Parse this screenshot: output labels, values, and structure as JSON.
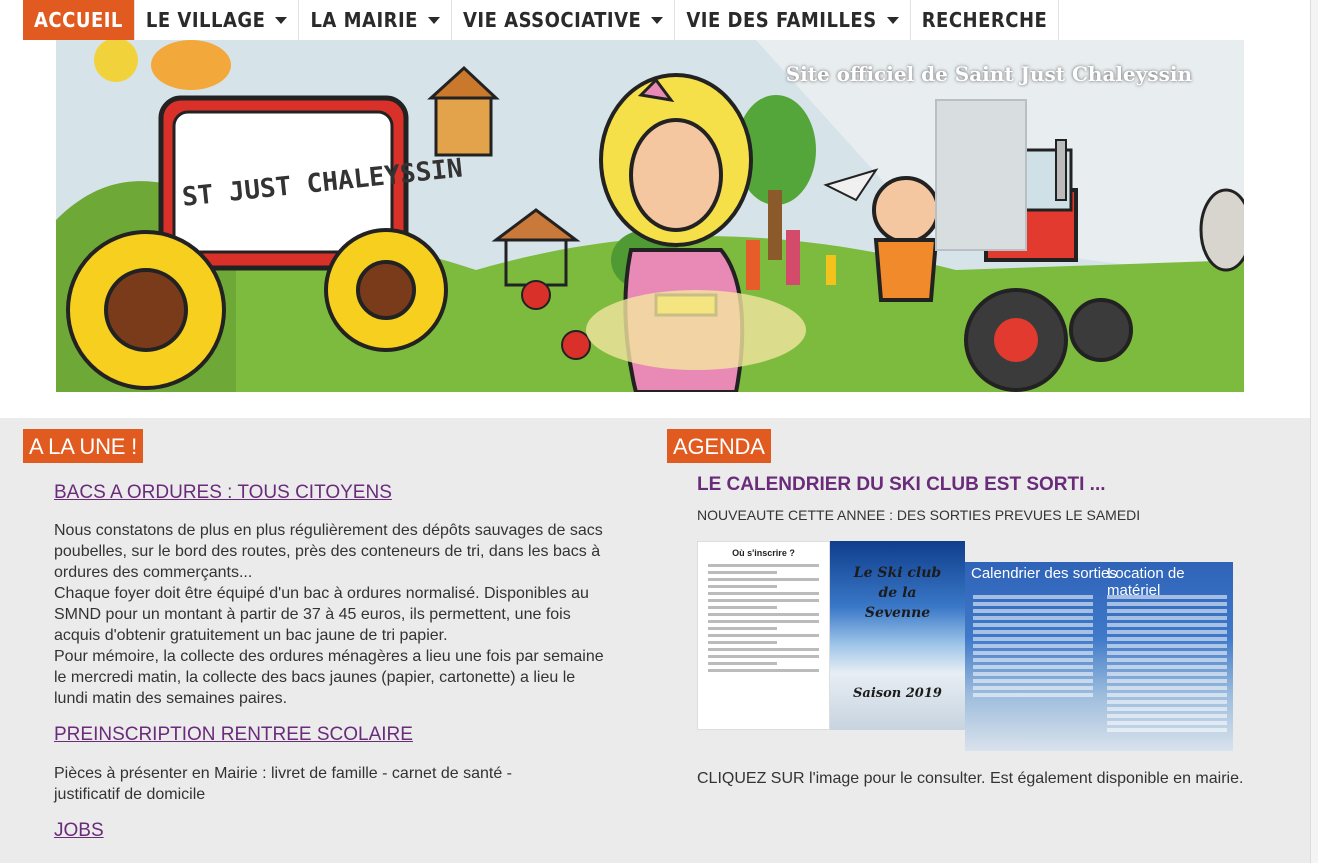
{
  "nav": {
    "items": [
      {
        "label": "ACCUEIL",
        "dropdown": false,
        "active": true
      },
      {
        "label": "LE VILLAGE",
        "dropdown": true,
        "active": false
      },
      {
        "label": "LA MAIRIE",
        "dropdown": true,
        "active": false
      },
      {
        "label": "VIE ASSOCIATIVE",
        "dropdown": true,
        "active": false
      },
      {
        "label": "VIE DES FAMILLES",
        "dropdown": true,
        "active": false
      },
      {
        "label": "RECHERCHE",
        "dropdown": false,
        "active": false
      }
    ]
  },
  "banner": {
    "title": "Site officiel de Saint Just Chaleyssin",
    "sign_text": "ST JUST CHALEYSSIN"
  },
  "une": {
    "heading": "A LA UNE !",
    "articles": [
      {
        "title": "BACS A ORDURES : TOUS CITOYENS",
        "paragraphs": [
          "Nous constatons de plus en plus régulièrement des dépôts sauvages de sacs poubelles, sur le bord des routes, près des conteneurs de tri, dans les bacs à ordures des commerçants...",
          "Chaque foyer doit être équipé d'un bac à ordures normalisé. Disponibles au SMND pour un montant à partir de 37 à 45 euros, ils permettent, une fois acquis d'obtenir gratuitement un bac jaune de tri papier.",
          "Pour mémoire, la collecte des ordures ménagères a lieu une fois par semaine le mercredi matin, la collecte des bacs jaunes (papier, cartonette) a lieu le lundi matin des semaines paires."
        ]
      },
      {
        "title": "PREINSCRIPTION RENTREE SCOLAIRE",
        "paragraphs": [
          "Pièces à présenter en Mairie : livret de famille - carnet de santé - justificatif de domicile"
        ]
      },
      {
        "title": "JOBS",
        "paragraphs": []
      }
    ]
  },
  "agenda": {
    "heading": "AGENDA",
    "title": "LE CALENDRIER DU SKI CLUB EST SORTI ...",
    "subtitle": "NOUVEAUTE CETTE ANNEE : DES SORTIES PREVUES LE SAMEDI",
    "cal_left_heading": "Où s'inscrire ?",
    "cal_mid_title_1": "Le Ski club",
    "cal_mid_title_2": "de la",
    "cal_mid_title_3": "Sevenne",
    "cal_mid_season": "Saison 2019",
    "cal_right_h1": "Calendrier des sorties",
    "cal_right_h2": "Location de matériel",
    "note": " CLIQUEZ SUR l'image pour le consulter. Est également disponible en mairie."
  }
}
